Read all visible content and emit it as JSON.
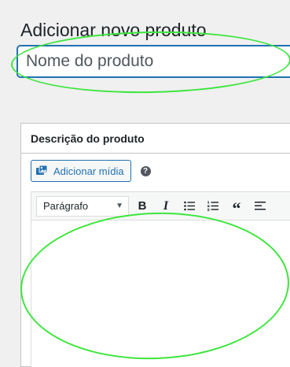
{
  "page": {
    "title": "Adicionar novo produto"
  },
  "product_title": {
    "placeholder": "Nome do produto",
    "value": ""
  },
  "description_box": {
    "title": "Descrição do produto",
    "add_media_label": "Adicionar mídia",
    "help_icon": "question-circle-icon",
    "toolbar": {
      "format_selected": "Parágrafo",
      "buttons": [
        "bold-icon",
        "italic-icon",
        "bulleted-list-icon",
        "numbered-list-icon",
        "blockquote-icon",
        "align-left-icon"
      ]
    },
    "content": ""
  },
  "colors": {
    "accent": "#2271b1",
    "annotation": "#3ee63e",
    "background": "#f0f0f1"
  }
}
